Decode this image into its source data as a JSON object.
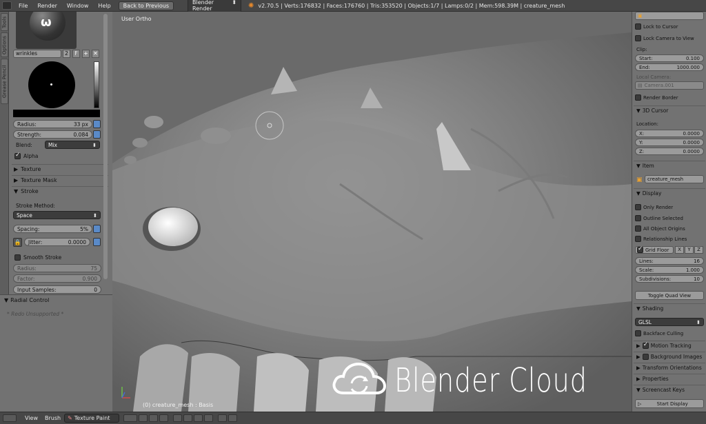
{
  "menu": {
    "file": "File",
    "render": "Render",
    "window": "Window",
    "help": "Help"
  },
  "back_button": "Back to Previous",
  "engine": "Blender Render",
  "stats": "v2.70.5 | Verts:176832 | Faces:176760 | Tris:353520 | Objects:1/7 | Lamps:0/2 | Mem:598.39M | creature_mesh",
  "left_tabs": [
    "Tools",
    "Options",
    "Grease Pencil"
  ],
  "brush": {
    "name": "wrinkles",
    "users": "2",
    "fake_user": "F",
    "radius_label": "Radius:",
    "radius_value": "33 px",
    "strength_label": "Strength:",
    "strength_value": "0.084",
    "blend_label": "Blend:",
    "blend_value": "Mix",
    "alpha_label": "Alpha"
  },
  "sections": {
    "texture": "Texture",
    "texture_mask": "Texture Mask",
    "stroke": "Stroke"
  },
  "stroke": {
    "method_label": "Stroke Method:",
    "method_value": "Space",
    "spacing_label": "Spacing:",
    "spacing_value": "5%",
    "jitter_label": "Jitter:",
    "jitter_value": "0.0000",
    "smooth_label": "Smooth Stroke",
    "radius_label": "Radius:",
    "radius_value": "75",
    "factor_label": "Factor:",
    "factor_value": "0.900",
    "input_samples_label": "Input Samples:",
    "input_samples_value": "0"
  },
  "radial": {
    "title": "Radial Control",
    "redo": "* Redo Unsupported *"
  },
  "viewport": {
    "view_label": "User Ortho",
    "object_label": "(0) creature_mesh : Basis"
  },
  "right": {
    "lock_cursor": "Lock to Cursor",
    "lock_camera": "Lock Camera to View",
    "clip_label": "Clip:",
    "start_label": "Start:",
    "start_value": "0.100",
    "end_label": "End:",
    "end_value": "1000.000",
    "local_camera_label": "Local Camera:",
    "camera_value": "Camera.001",
    "render_border": "Render Border",
    "cursor_section": "3D Cursor",
    "location_label": "Location:",
    "x_label": "X:",
    "x_value": "0.0000",
    "y_label": "Y:",
    "y_value": "0.0000",
    "z_label": "Z:",
    "z_value": "0.0000",
    "item_section": "Item",
    "item_name": "creature_mesh",
    "display_section": "Display",
    "only_render": "Only Render",
    "outline_selected": "Outline Selected",
    "all_object_origins": "All Object Origins",
    "relationship_lines": "Relationship Lines",
    "grid_floor": "Grid Floor",
    "axis_x": "X",
    "axis_y": "Y",
    "axis_z": "Z",
    "lines_label": "Lines:",
    "lines_value": "16",
    "scale_label": "Scale:",
    "scale_value": "1.000",
    "subdiv_label": "Subdivisions:",
    "subdiv_value": "10",
    "toggle_quad": "Toggle Quad View",
    "shading_section": "Shading",
    "shading_value": "GLSL",
    "backface": "Backface Culling",
    "motion_tracking": "Motion Tracking",
    "background_images": "Background Images",
    "transform_orientations": "Transform Orientations",
    "properties": "Properties",
    "screencast_keys": "Screencast Keys",
    "start_display": "Start Display"
  },
  "bottom": {
    "view": "View",
    "brush": "Brush",
    "mode": "Texture Paint"
  },
  "watermark": "Blender Cloud",
  "colors": {
    "panel": "#727272",
    "header": "#474747",
    "accent_blue": "#5a8ac8"
  }
}
